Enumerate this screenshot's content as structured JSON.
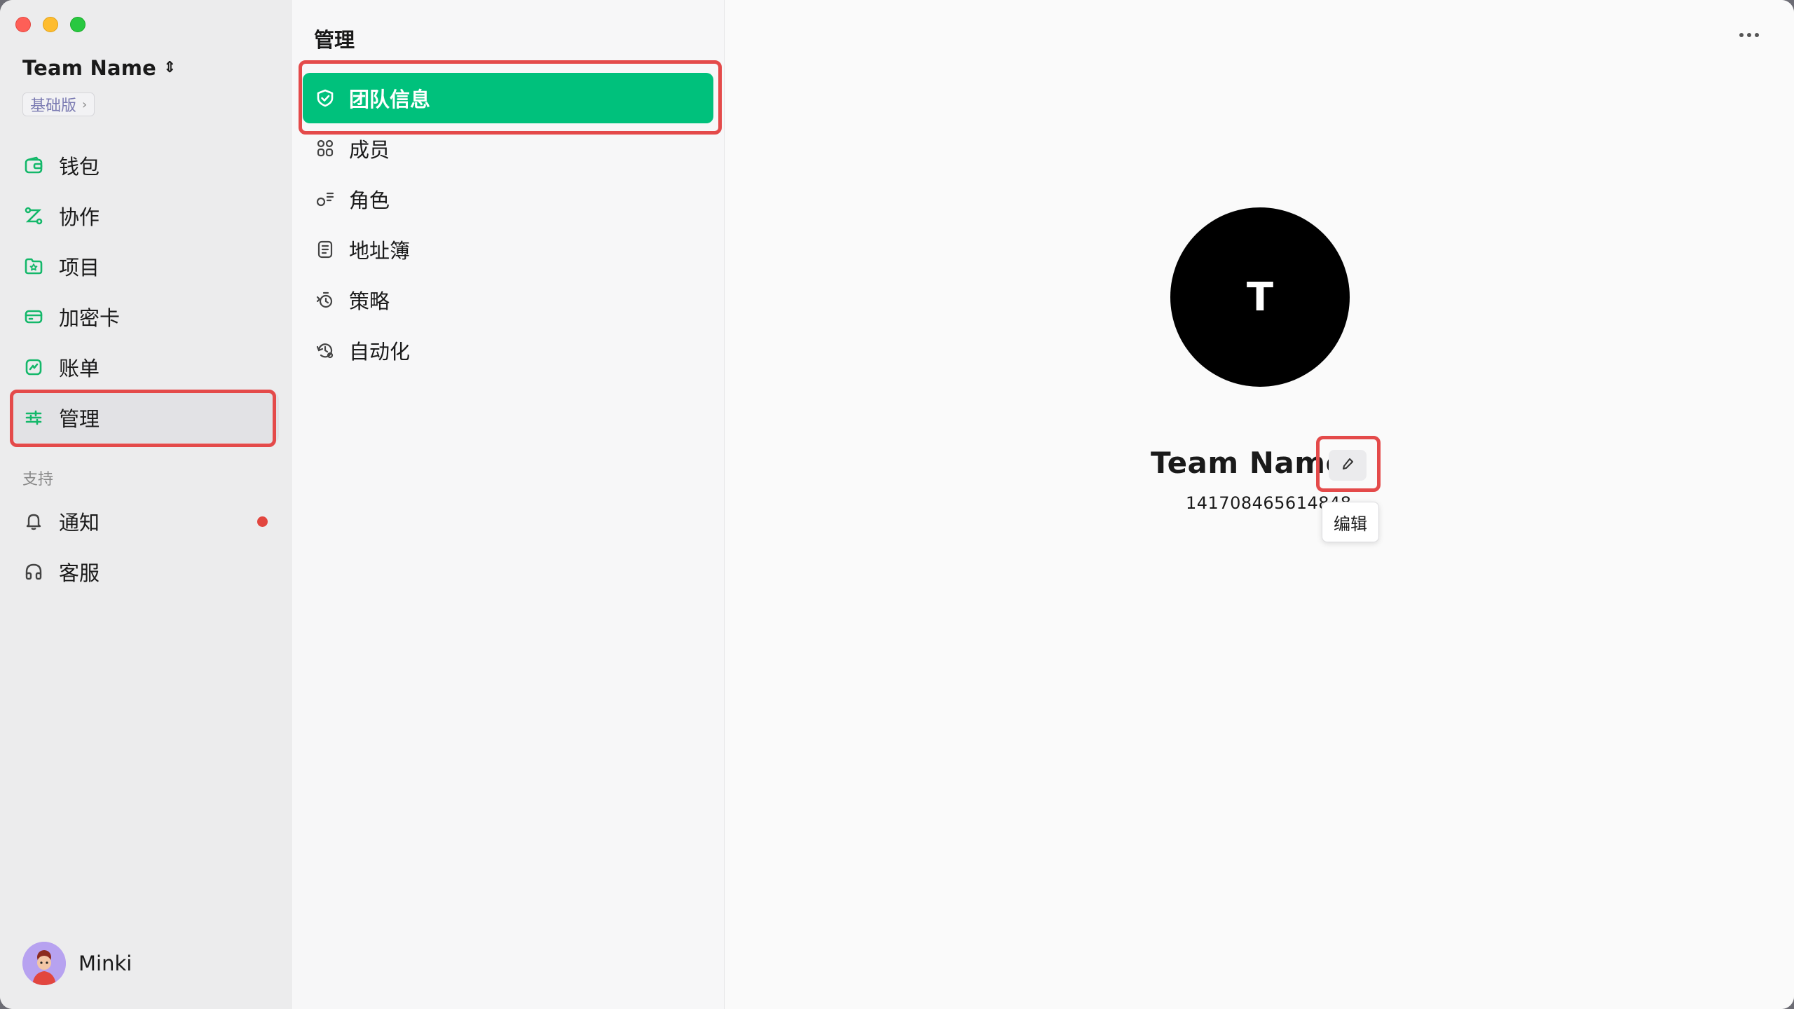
{
  "sidebar": {
    "team_name": "Team Name",
    "team_switch_icon": "chevron-updown-icon",
    "plan_label": "基础版",
    "plan_chevron": "›",
    "items": [
      {
        "label": "钱包",
        "icon": "wallet-icon"
      },
      {
        "label": "协作",
        "icon": "collaboration-icon"
      },
      {
        "label": "项目",
        "icon": "project-icon"
      },
      {
        "label": "加密卡",
        "icon": "card-icon"
      },
      {
        "label": "账单",
        "icon": "bill-icon"
      },
      {
        "label": "管理",
        "icon": "sliders-icon",
        "active": true
      }
    ],
    "support_section": "支持",
    "support_items": [
      {
        "label": "通知",
        "icon": "bell-icon",
        "has_dot": true
      },
      {
        "label": "客服",
        "icon": "headphones-icon"
      }
    ],
    "user": {
      "name": "Minki",
      "avatar": "avatar"
    }
  },
  "management": {
    "title": "管理",
    "items": [
      {
        "label": "团队信息",
        "icon": "shield-check-icon",
        "active": true
      },
      {
        "label": "成员",
        "icon": "members-icon"
      },
      {
        "label": "角色",
        "icon": "role-icon"
      },
      {
        "label": "地址簿",
        "icon": "address-book-icon"
      },
      {
        "label": "策略",
        "icon": "policy-icon"
      },
      {
        "label": "自动化",
        "icon": "automation-icon"
      }
    ]
  },
  "team_info": {
    "avatar_letter": "T",
    "name": "Team Name",
    "id": "141708465614848",
    "id_visible": "14170846561484",
    "edit_tooltip": "编辑",
    "edit_icon": "pencil-icon",
    "more_icon": "more-horizontal-icon"
  },
  "colors": {
    "accent": "#00c17c",
    "accent_icon": "#14b86a",
    "highlight_border": "#e44a4a",
    "notify_dot": "#e2463f",
    "plan_text": "#7b7bb2"
  }
}
